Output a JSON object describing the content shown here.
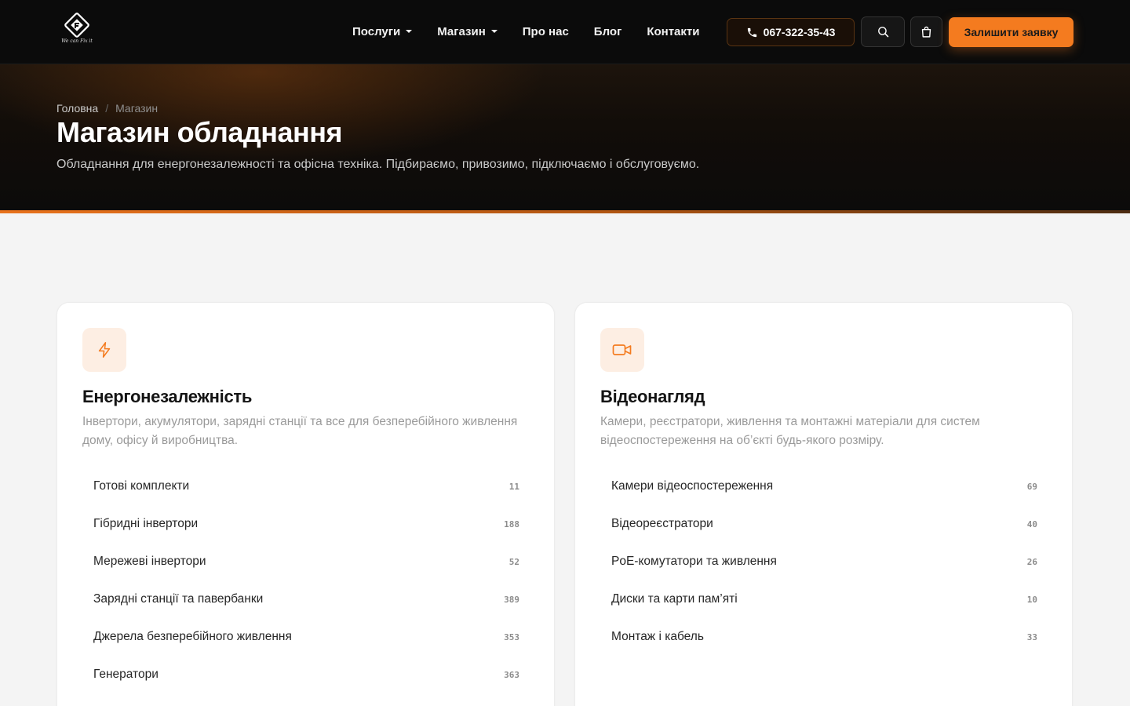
{
  "header": {
    "logo_tagline": "We can Fix it",
    "nav": [
      {
        "label": "Послуги",
        "dropdown": true
      },
      {
        "label": "Магазин",
        "dropdown": true
      },
      {
        "label": "Про нас",
        "dropdown": false
      },
      {
        "label": "Блог",
        "dropdown": false
      },
      {
        "label": "Контакти",
        "dropdown": false
      }
    ],
    "phone": "067-322-35-43",
    "cta_label": "Залишити заявку",
    "icons": [
      "phone-icon",
      "search-icon",
      "shopping-bag-icon"
    ]
  },
  "hero": {
    "breadcrumb": {
      "home": "Головна",
      "current": "Магазин"
    },
    "title": "Магазин обладнання",
    "subtitle": "Обладнання для енергонезалежності та офісна техніка. Підбираємо, привозимо, підключаємо і обслуговуємо."
  },
  "categories": [
    {
      "icon": "lightning-icon",
      "title": "Енергонезалежність",
      "description": "Інвертори, акумулятори, зарядні станції та все для безперебійного живлення дому, офісу й виробництва.",
      "items": [
        {
          "name": "Готові комплекти",
          "count": "11"
        },
        {
          "name": "Гібридні інвертори",
          "count": "188"
        },
        {
          "name": "Мережеві інвертори",
          "count": "52"
        },
        {
          "name": "Зарядні станції та павербанки",
          "count": "389"
        },
        {
          "name": "Джерела безперебійного живлення",
          "count": "353"
        },
        {
          "name": "Генератори",
          "count": "363"
        }
      ]
    },
    {
      "icon": "video-camera-icon",
      "title": "Відеонагляд",
      "description": "Камери, реєстратори, живлення та монтажні матеріали для систем відеоспостереження на об’єкті будь-якого розміру.",
      "items": [
        {
          "name": "Камери відеоспостереження",
          "count": "69"
        },
        {
          "name": "Відеореєстратори",
          "count": "40"
        },
        {
          "name": "PoE-комутатори та живлення",
          "count": "26"
        },
        {
          "name": "Диски та карти пам’яті",
          "count": "10"
        },
        {
          "name": "Монтаж і кабель",
          "count": "33"
        }
      ]
    }
  ],
  "colors": {
    "accent": "#f47b1f",
    "header_bg": "#0b0b0b",
    "page_bg": "#f4f4f4",
    "icon_tint_bg": "#fdeee3"
  }
}
